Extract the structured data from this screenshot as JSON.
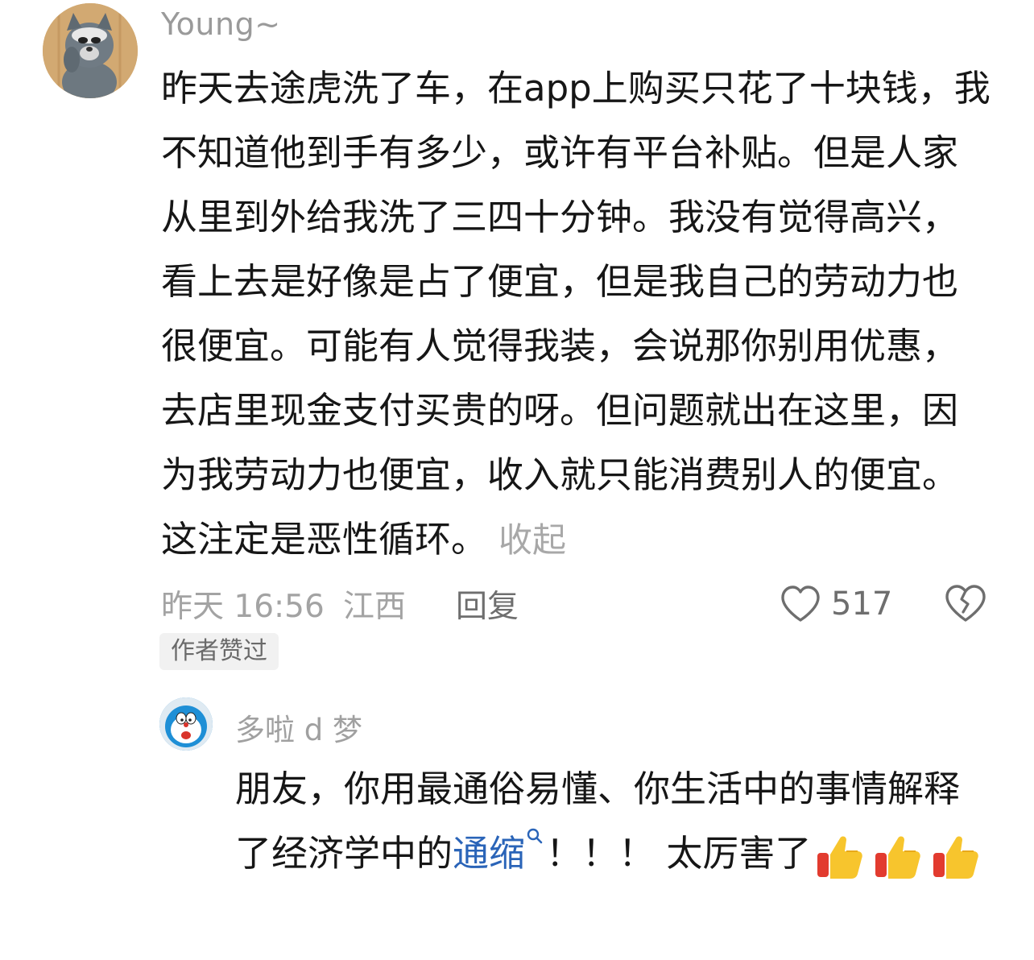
{
  "main_comment": {
    "username": "Young~",
    "text": "昨天去途虎洗了车，在app上购买只花了十块钱，我不知道他到手有多少，或许有平台补贴。但是人家从里到外给我洗了三四十分钟。我没有觉得高兴，看上去是好像是占了便宜，但是我自己的劳动力也很便宜。可能有人觉得我装，会说那你别用优惠，去店里现金支付买贵的呀。但问题就出在这里，因为我劳动力也便宜，收入就只能消费别人的便宜。这注定是恶性循环。",
    "collapse_label": "收起",
    "time": "昨天 16:56",
    "location": "江西",
    "reply_label": "回复",
    "like_count": "517",
    "author_badge": "作者赞过"
  },
  "reply_comment": {
    "username": "多啦 d 梦",
    "text_before": "朋友，你用最通俗易懂、你生活中的事情解释了经济学中的",
    "link_text": "通缩",
    "text_after": "！！！ 太厉害了"
  },
  "icons": {
    "heart": "heart-outline-icon",
    "dislike": "broken-heart-icon",
    "search": "search-icon",
    "thumbs_up": "thumbs-up-emoji"
  }
}
